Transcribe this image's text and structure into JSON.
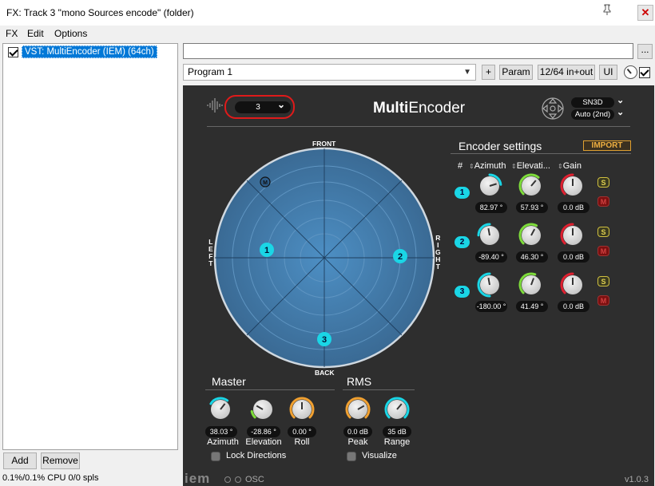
{
  "window": {
    "title": "FX: Track 3 \"mono Sources encode\" (folder)",
    "pin_icon": "pin-icon",
    "close_icon": "close-icon"
  },
  "menu": [
    "FX",
    "Edit",
    "Options"
  ],
  "fx_list": {
    "items": [
      {
        "label": "VST: MultiEncoder (IEM) (64ch)",
        "enabled": true
      }
    ]
  },
  "buttons": {
    "add": "Add",
    "remove": "Remove",
    "preset_menu": "...",
    "plus": "+",
    "param": "Param",
    "io": "12/64 in+out",
    "ui": "UI"
  },
  "status": {
    "cpu": "0.1%/0.1% CPU 0/0 spls"
  },
  "preset": {
    "name": "",
    "program": "Program 1"
  },
  "plugin": {
    "title_bold": "Multi",
    "title_rest": "Encoder",
    "num_sources": "3",
    "normalization": "SN3D",
    "weighting": "Auto (2nd)",
    "directions": {
      "front": "FRONT",
      "back": "BACK",
      "left": [
        "L",
        "E",
        "F",
        "T"
      ],
      "right": [
        "R",
        "I",
        "G",
        "H",
        "T"
      ]
    },
    "master_marker": "M",
    "encoder_settings": {
      "title": "Encoder settings",
      "import_label": "IMPORT",
      "headers": {
        "num": "#",
        "azimuth": "Azimuth",
        "elevation": "Elevati...",
        "gain": "Gain"
      },
      "sources": [
        {
          "num": "1",
          "azimuth": "82.97 °",
          "elevation": "57.93 °",
          "gain": "0.0 dB",
          "solo": "S",
          "mute": "M"
        },
        {
          "num": "2",
          "azimuth": "-89.40 °",
          "elevation": "46.30 °",
          "gain": "0.0 dB",
          "solo": "S",
          "mute": "M"
        },
        {
          "num": "3",
          "azimuth": "-180.00 °",
          "elevation": "41.49 °",
          "gain": "0.0 dB",
          "solo": "S",
          "mute": "M"
        }
      ]
    },
    "master": {
      "title": "Master",
      "azimuth": "38.03 °",
      "elevation": "-28.86 °",
      "roll": "0.00 °",
      "azimuth_label": "Azimuth",
      "elevation_label": "Elevation",
      "roll_label": "Roll",
      "lock_label": "Lock Directions"
    },
    "rms": {
      "title": "RMS",
      "peak": "0.0 dB",
      "range": "35 dB",
      "peak_label": "Peak",
      "range_label": "Range",
      "visualize_label": "Visualize"
    },
    "footer": {
      "logo": "iem",
      "osc": "OSC",
      "version": "v1.0.3"
    },
    "colors": {
      "cyan": "#1ad6e6",
      "green": "#7ddb3a",
      "red": "#e02030",
      "orange": "#f0a030",
      "highlight": "#e01a1a"
    }
  }
}
